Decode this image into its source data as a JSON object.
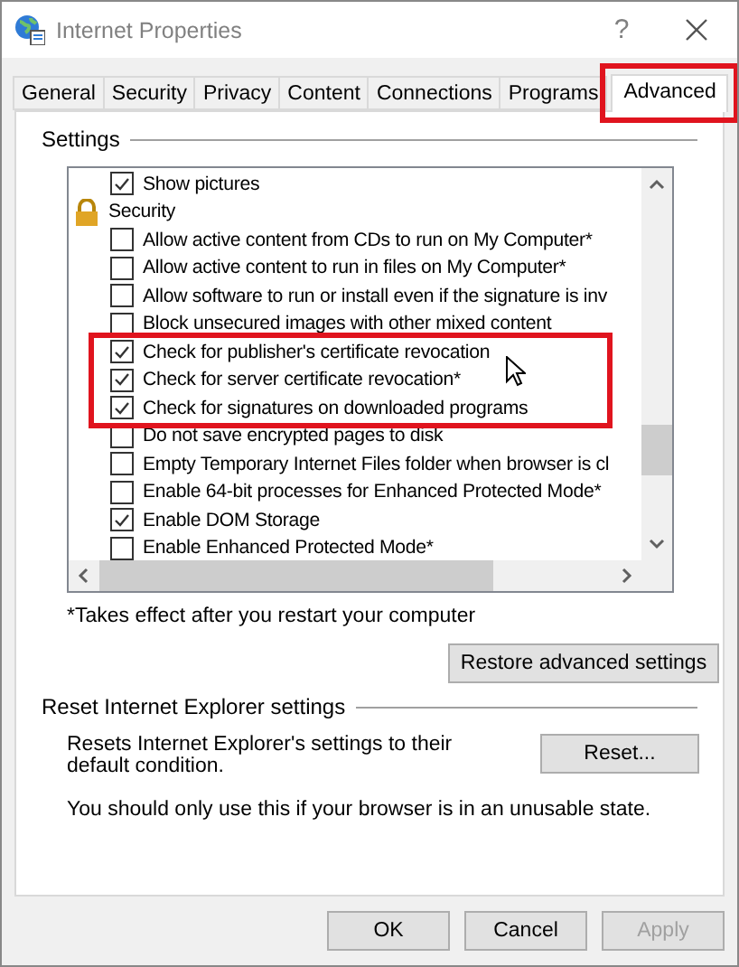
{
  "window": {
    "title": "Internet Properties",
    "help": "?"
  },
  "tabs": [
    {
      "label": "General",
      "selected": false,
      "highlighted": false
    },
    {
      "label": "Security",
      "selected": false,
      "highlighted": false
    },
    {
      "label": "Privacy",
      "selected": false,
      "highlighted": false
    },
    {
      "label": "Content",
      "selected": false,
      "highlighted": false
    },
    {
      "label": "Connections",
      "selected": false,
      "highlighted": false
    },
    {
      "label": "Programs",
      "selected": false,
      "highlighted": false
    },
    {
      "label": "Advanced",
      "selected": true,
      "highlighted": true
    }
  ],
  "settings": {
    "legend": "Settings",
    "items": [
      {
        "kind": "checkbox",
        "label": "Show pictures",
        "checked": true,
        "highlighted": false
      },
      {
        "kind": "category",
        "label": "Security"
      },
      {
        "kind": "checkbox",
        "label": "Allow active content from CDs to run on My Computer*",
        "checked": false,
        "highlighted": false
      },
      {
        "kind": "checkbox",
        "label": "Allow active content to run in files on My Computer*",
        "checked": false,
        "highlighted": false
      },
      {
        "kind": "checkbox",
        "label": "Allow software to run or install even if the signature is inv",
        "checked": false,
        "highlighted": false
      },
      {
        "kind": "checkbox",
        "label": "Block unsecured images with other mixed content",
        "checked": false,
        "highlighted": false
      },
      {
        "kind": "checkbox",
        "label": "Check for publisher's certificate revocation",
        "checked": true,
        "highlighted": true
      },
      {
        "kind": "checkbox",
        "label": "Check for server certificate revocation*",
        "checked": true,
        "highlighted": true
      },
      {
        "kind": "checkbox",
        "label": "Check for signatures on downloaded programs",
        "checked": true,
        "highlighted": true
      },
      {
        "kind": "checkbox",
        "label": "Do not save encrypted pages to disk",
        "checked": false,
        "highlighted": false
      },
      {
        "kind": "checkbox",
        "label": "Empty Temporary Internet Files folder when browser is cl",
        "checked": false,
        "highlighted": false
      },
      {
        "kind": "checkbox",
        "label": "Enable 64-bit processes for Enhanced Protected Mode*",
        "checked": false,
        "highlighted": false
      },
      {
        "kind": "checkbox",
        "label": "Enable DOM Storage",
        "checked": true,
        "highlighted": false
      },
      {
        "kind": "checkbox",
        "label": "Enable Enhanced Protected Mode*",
        "checked": false,
        "highlighted": false
      }
    ],
    "note": "*Takes effect after you restart your computer",
    "restore_button": "Restore advanced settings"
  },
  "reset": {
    "legend": "Reset Internet Explorer settings",
    "description": "Resets Internet Explorer's settings to their default condition.",
    "button": "Reset...",
    "warning": "You should only use this if your browser is in an unusable state."
  },
  "buttons": [
    {
      "label": "OK",
      "disabled": false
    },
    {
      "label": "Cancel",
      "disabled": false
    },
    {
      "label": "Apply",
      "disabled": true
    }
  ]
}
